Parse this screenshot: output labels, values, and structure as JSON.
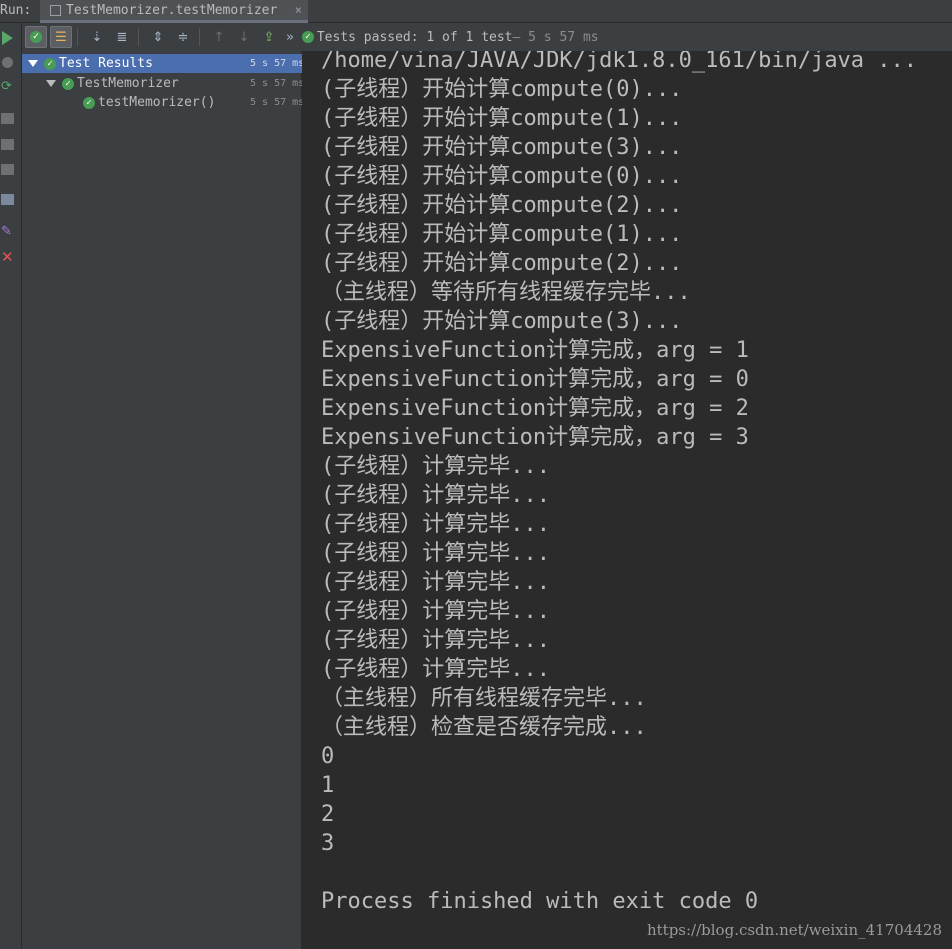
{
  "run_label": "Run:",
  "tab": {
    "title": "TestMemorizer.testMemorizer",
    "close": "×"
  },
  "status": {
    "passed_text": "Tests passed: 1 of 1 test",
    "time_text": " — 5 s 57 ms",
    "chevron": "»"
  },
  "toolbar_icons": [
    "check-filter-icon",
    "list-filter-icon",
    "sort-down-icon",
    "sort-alpha-icon",
    "expand-all-icon",
    "collapse-all-icon",
    "prev-icon",
    "next-icon",
    "export-icon"
  ],
  "tree": [
    {
      "label": "Test Results",
      "time": "5 s 57 ms",
      "selected": true
    },
    {
      "label": "TestMemorizer",
      "time": "5 s 57 ms"
    },
    {
      "label": "testMemorizer()",
      "time": "5 s 57 ms"
    }
  ],
  "console_lines": [
    "/home/vina/JAVA/JDK/jdk1.8.0_161/bin/java ...",
    "(子线程）开始计算compute(0)...",
    "(子线程）开始计算compute(1)...",
    "(子线程）开始计算compute(3)...",
    "(子线程）开始计算compute(0)...",
    "(子线程）开始计算compute(2)...",
    "(子线程）开始计算compute(1)...",
    "(子线程）开始计算compute(2)...",
    "（主线程）等待所有线程缓存完毕...",
    "(子线程）开始计算compute(3)...",
    "ExpensiveFunction计算完成，arg = 1",
    "ExpensiveFunction计算完成，arg = 0",
    "ExpensiveFunction计算完成，arg = 2",
    "ExpensiveFunction计算完成，arg = 3",
    "(子线程）计算完毕...",
    "(子线程）计算完毕...",
    "(子线程）计算完毕...",
    "(子线程）计算完毕...",
    "(子线程）计算完毕...",
    "(子线程）计算完毕...",
    "(子线程）计算完毕...",
    "(子线程）计算完毕...",
    "（主线程）所有线程缓存完毕...",
    "（主线程）检查是否缓存完成...",
    "0",
    "1",
    "2",
    "3",
    "",
    "Process finished with exit code 0"
  ],
  "watermark": "https://blog.csdn.net/weixin_41704428",
  "colors": {
    "accent_green": "#59a869",
    "selection": "#4b6eaf",
    "error_red": "#e05555"
  }
}
